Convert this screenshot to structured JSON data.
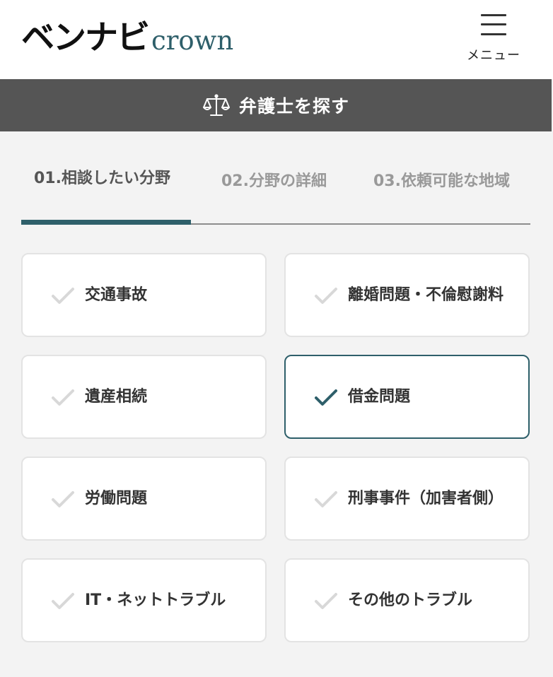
{
  "header": {
    "logo_main": "ベンナビ",
    "logo_sub": "crown",
    "menu_label": "メニュー"
  },
  "search_bar": {
    "title": "弁護士を探す",
    "icon": "scale-icon"
  },
  "tabs": [
    {
      "label": "01.相談したい分野",
      "active": true
    },
    {
      "label": "02.分野の詳細",
      "active": false
    },
    {
      "label": "03.依頼可能な地域",
      "active": false
    }
  ],
  "categories": [
    {
      "label": "交通事故",
      "selected": false
    },
    {
      "label": "離婚問題・不倫慰謝料",
      "selected": false
    },
    {
      "label": "遺産相続",
      "selected": false
    },
    {
      "label": "借金問題",
      "selected": true
    },
    {
      "label": "労働問題",
      "selected": false
    },
    {
      "label": "刑事事件（加害者側）",
      "selected": false
    },
    {
      "label": "IT・ネットトラブル",
      "selected": false
    },
    {
      "label": "その他のトラブル",
      "selected": false
    }
  ],
  "colors": {
    "accent": "#2e5f6a",
    "search_bar_bg": "#555555",
    "page_bg": "#f3f3f3",
    "check_inactive": "#d8d8d8"
  }
}
